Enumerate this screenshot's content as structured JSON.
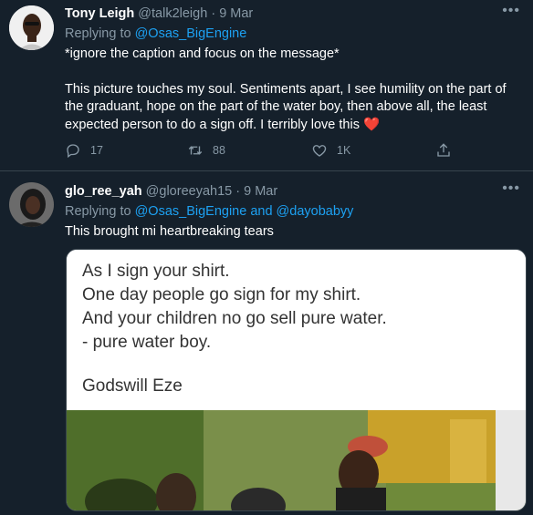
{
  "tweet1": {
    "name": "Tony Leigh",
    "handle": "@talk2leigh",
    "separator": "·",
    "date": "9 Mar",
    "replying_prefix": "Replying to",
    "replying_handles": "@Osas_BigEngine",
    "line1": "*ignore the caption and focus on the message*",
    "line2": "This picture touches my soul. Sentiments apart, I see humility on the part of the graduant, hope on the part of the water boy, then above all, the least expected person to do a sign off. I terribly love this",
    "emoji": "❤️",
    "reply_count": "17",
    "retweet_count": "88",
    "like_count": "1K"
  },
  "tweet2": {
    "name": "glo_ree_yah",
    "handle": "@gloreeyah15",
    "separator": "·",
    "date": "9 Mar",
    "replying_prefix": "Replying to",
    "replying_handles": "@Osas_BigEngine and @dayobabyy",
    "text": "This brought mi heartbreaking tears",
    "image_lines": [
      "As I sign your shirt.",
      "One day people go sign for my shirt.",
      "And your children no go sell pure water.",
      "- pure water boy.",
      "Godswill Eze"
    ]
  },
  "icons": [
    "more-icon",
    "reply-icon",
    "retweet-icon",
    "like-icon",
    "share-icon",
    "heart-emoji-icon"
  ],
  "colors": {
    "background": "#15202b",
    "link": "#1da1f2",
    "muted": "#8899a6",
    "heart": "#e0245e",
    "divider": "#38444d"
  }
}
